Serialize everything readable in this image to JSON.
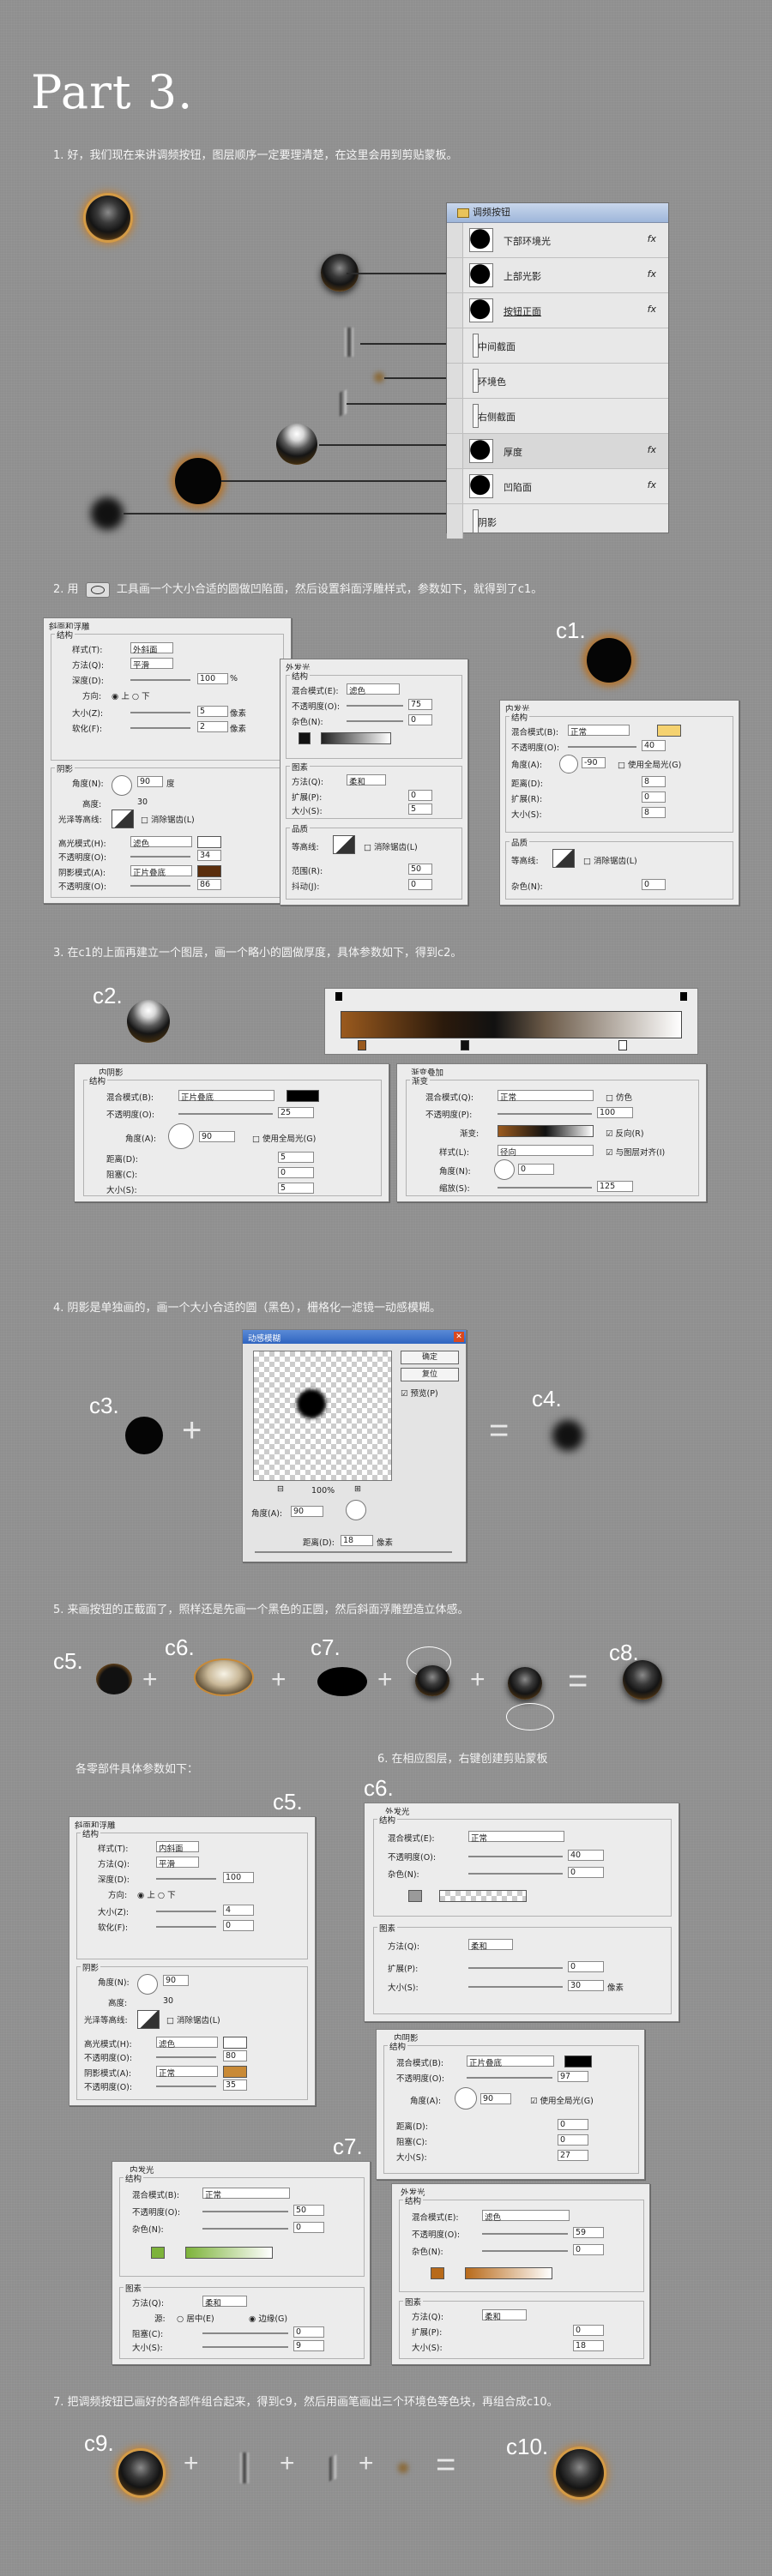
{
  "title": "Part 3.",
  "steps": {
    "s1": "1. 好，我们现在来讲调频按钮，图层顺序一定要理清楚，在这里会用到剪贴蒙板。",
    "s2a": "2. 用",
    "s2b": "工具画一个大小合适的圆做凹陷面，然后设置斜面浮雕样式，参数如下，就得到了c1。",
    "s3": "3. 在c1的上面再建立一个图层，画一个略小的圆做厚度，具体参数如下，得到c2。",
    "s4": "4. 阴影是单独画的，画一个大小合适的圆（黑色），栅格化一滤镜一动感模糊。",
    "s5": "5. 来画按钮的正截面了，照样还是先画一个黑色的正圆，然后斜面浮雕塑造立体感。",
    "s5b": "各零部件具体参数如下：",
    "s6": "6. 在相应图层，右键创建剪贴蒙板",
    "s7": "7. 把调频按钮已画好的各部件组合起来，得到c9，然后用画笔画出三个环境色等色块，再组合成c10。"
  },
  "layers_panel": {
    "group_name": "调频按钮",
    "rows": [
      {
        "name": "下部环境光",
        "fx": "fx"
      },
      {
        "name": "上部光影",
        "fx": "fx"
      },
      {
        "name": "按钮正面",
        "fx": "fx"
      },
      {
        "name": "中间截面",
        "fx": ""
      },
      {
        "name": "环境色",
        "fx": ""
      },
      {
        "name": "右侧截面",
        "fx": ""
      },
      {
        "name": "厚度",
        "fx": "fx"
      },
      {
        "name": "凹陷面",
        "fx": "fx"
      },
      {
        "name": "阴影",
        "fx": ""
      }
    ]
  },
  "labels": {
    "c1": "c1.",
    "c2": "c2.",
    "c3": "c3.",
    "c4": "c4.",
    "c5": "c5.",
    "c6": "c6.",
    "c7": "c7.",
    "c8": "c8.",
    "c5b": "c5.",
    "c6b": "c6.",
    "c7b": "c7.",
    "c9": "c9.",
    "c10": "c10."
  },
  "symbols": {
    "plus": "+",
    "eq": "="
  },
  "bevel1": {
    "title": "斜面和浮雕",
    "struct": "结构",
    "style_l": "样式(T):",
    "style": "外斜面",
    "method_l": "方法(Q):",
    "method": "平滑",
    "depth_l": "深度(D):",
    "depth": "100",
    "dir_l": "方向:",
    "up": "上",
    "down": "下",
    "size_l": "大小(Z):",
    "size": "5",
    "soft_l": "软化(F):",
    "soft": "2",
    "shade": "阴影",
    "angle_l": "角度(N):",
    "angle": "90",
    "alt_l": "高度:",
    "alt": "30",
    "gloss_l": "光泽等高线:",
    "aa": "消除锯齿(L)",
    "hi_l": "高光模式(H):",
    "hi": "滤色",
    "op_l": "不透明度(O):",
    "op1": "34",
    "sh_l": "阴影模式(A):",
    "sh": "正片叠底",
    "op2": "86",
    "unit_px": "像素",
    "unit_deg": "度",
    "pct": "%"
  },
  "glow1": {
    "title": "外发光",
    "struct": "结构",
    "blend_l": "混合模式(E):",
    "blend": "滤色",
    "op_l": "不透明度(O):",
    "op": "75",
    "noise_l": "杂色(N):",
    "noise": "0",
    "elems": "图素",
    "method_l": "方法(Q):",
    "method": "柔和",
    "spread_l": "扩展(P):",
    "spread": "0",
    "size_l": "大小(S):",
    "size": "5",
    "quality": "品质",
    "contour_l": "等高线:",
    "aa": "消除锯齿(L)",
    "range_l": "范围(R):",
    "range": "50",
    "jitter_l": "抖动(J):",
    "jitter": "0"
  },
  "innerglow1": {
    "title": "内发光",
    "struct": "结构",
    "blend_l": "混合模式(B):",
    "blend": "正常",
    "op_l": "不透明度(O):",
    "op": "40",
    "angle_l": "角度(A):",
    "angle": "-90",
    "global": "使用全局光(G)",
    "dist_l": "距离(D):",
    "dist": "8",
    "spread_l": "扩展(R):",
    "spread": "0",
    "size_l": "大小(S):",
    "size": "8",
    "quality": "品质",
    "contour_l": "等高线:",
    "aa": "消除锯齿(L)",
    "noise_l": "杂色(N):",
    "noise": "0"
  },
  "inner2": {
    "title": "内阴影",
    "struct": "结构",
    "blend_l": "混合模式(B):",
    "blend": "正片叠底",
    "op_l": "不透明度(O):",
    "op": "25",
    "angle_l": "角度(A):",
    "angle": "90",
    "global": "使用全局光(G)",
    "dist_l": "距离(D):",
    "dist": "5",
    "choke_l": "阻塞(C):",
    "choke": "0",
    "size_l": "大小(S):",
    "size": "5"
  },
  "grad2": {
    "title": "渐变叠加",
    "sub": "渐变",
    "blend_l": "混合模式(Q):",
    "blend": "正常",
    "dither": "仿色",
    "op_l": "不透明度(P):",
    "op": "100",
    "grad_l": "渐变:",
    "rev": "反向(R)",
    "style_l": "样式(L):",
    "style": "径向",
    "align": "与图层对齐(I)",
    "angle_l": "角度(N):",
    "angle": "0",
    "scale_l": "缩放(S):",
    "scale": "125"
  },
  "blurdlg": {
    "title": "动感模糊",
    "ok": "确定",
    "reset": "复位",
    "preview": "预览(P)",
    "zoom": "100%",
    "angle_l": "角度(A):",
    "angle": "90",
    "dist_l": "距离(D):",
    "dist": "18",
    "unit": "像素"
  },
  "bevel5": {
    "title": "斜面和浮雕",
    "struct": "结构",
    "style_l": "样式(T):",
    "style": "内斜面",
    "method_l": "方法(Q):",
    "method": "平滑",
    "depth_l": "深度(D):",
    "depth": "100",
    "dir_l": "方向:",
    "up": "上",
    "down": "下",
    "size_l": "大小(Z):",
    "size": "4",
    "soft_l": "软化(F):",
    "soft": "0",
    "shade": "阴影",
    "angle_l": "角度(N):",
    "angle": "90",
    "alt_l": "高度:",
    "alt": "30",
    "gloss_l": "光泽等高线:",
    "aa": "消除锯齿(L)",
    "hi_l": "高光模式(H):",
    "hi": "滤色",
    "op_l": "不透明度(O):",
    "op1": "80",
    "sh_l": "阴影模式(A):",
    "sh": "正常",
    "op2": "35"
  },
  "glow6": {
    "title": "外发光",
    "struct": "结构",
    "blend_l": "混合模式(E):",
    "blend": "正常",
    "op_l": "不透明度(O):",
    "op": "40",
    "noise_l": "杂色(N):",
    "noise": "0",
    "elems": "图素",
    "method_l": "方法(Q):",
    "method": "柔和",
    "spread_l": "扩展(P):",
    "spread": "0",
    "size_l": "大小(S):",
    "size": "30",
    "unit_px": "像素"
  },
  "inner7": {
    "title": "内阴影",
    "struct": "结构",
    "blend_l": "混合模式(B):",
    "blend": "正片叠底",
    "op_l": "不透明度(O):",
    "op": "97",
    "angle_l": "角度(A):",
    "angle": "90",
    "global": "使用全局光(G)",
    "dist_l": "距离(D):",
    "dist": "0",
    "choke_l": "阻塞(C):",
    "choke": "0",
    "size_l": "大小(S):",
    "size": "27"
  },
  "innerglow7": {
    "title": "内发光",
    "struct": "结构",
    "blend_l": "混合模式(B):",
    "blend": "正常",
    "op_l": "不透明度(O):",
    "op": "50",
    "noise_l": "杂色(N):",
    "noise": "0",
    "elems": "图素",
    "method_l": "方法(Q):",
    "method": "柔和",
    "src_l": "源:",
    "center": "居中(E)",
    "edge": "边缘(G)",
    "choke_l": "阻塞(C):",
    "choke": "0",
    "size_l": "大小(S):",
    "size": "9"
  },
  "glow7": {
    "title": "外发光",
    "struct": "结构",
    "blend_l": "混合模式(E):",
    "blend": "滤色",
    "op_l": "不透明度(O):",
    "op": "59",
    "noise_l": "杂色(N):",
    "noise": "0",
    "elems": "图素",
    "method_l": "方法(Q):",
    "method": "柔和",
    "spread_l": "扩展(P):",
    "spread": "0",
    "size_l": "大小(S):",
    "size": "18"
  },
  "colors": {
    "accent_orange": "#c98a36",
    "swatch_yellow": "#f5d270",
    "swatch_brown": "#8a4a10",
    "swatch_green": "#7db33a",
    "swatch_orange": "#b86a1a"
  }
}
